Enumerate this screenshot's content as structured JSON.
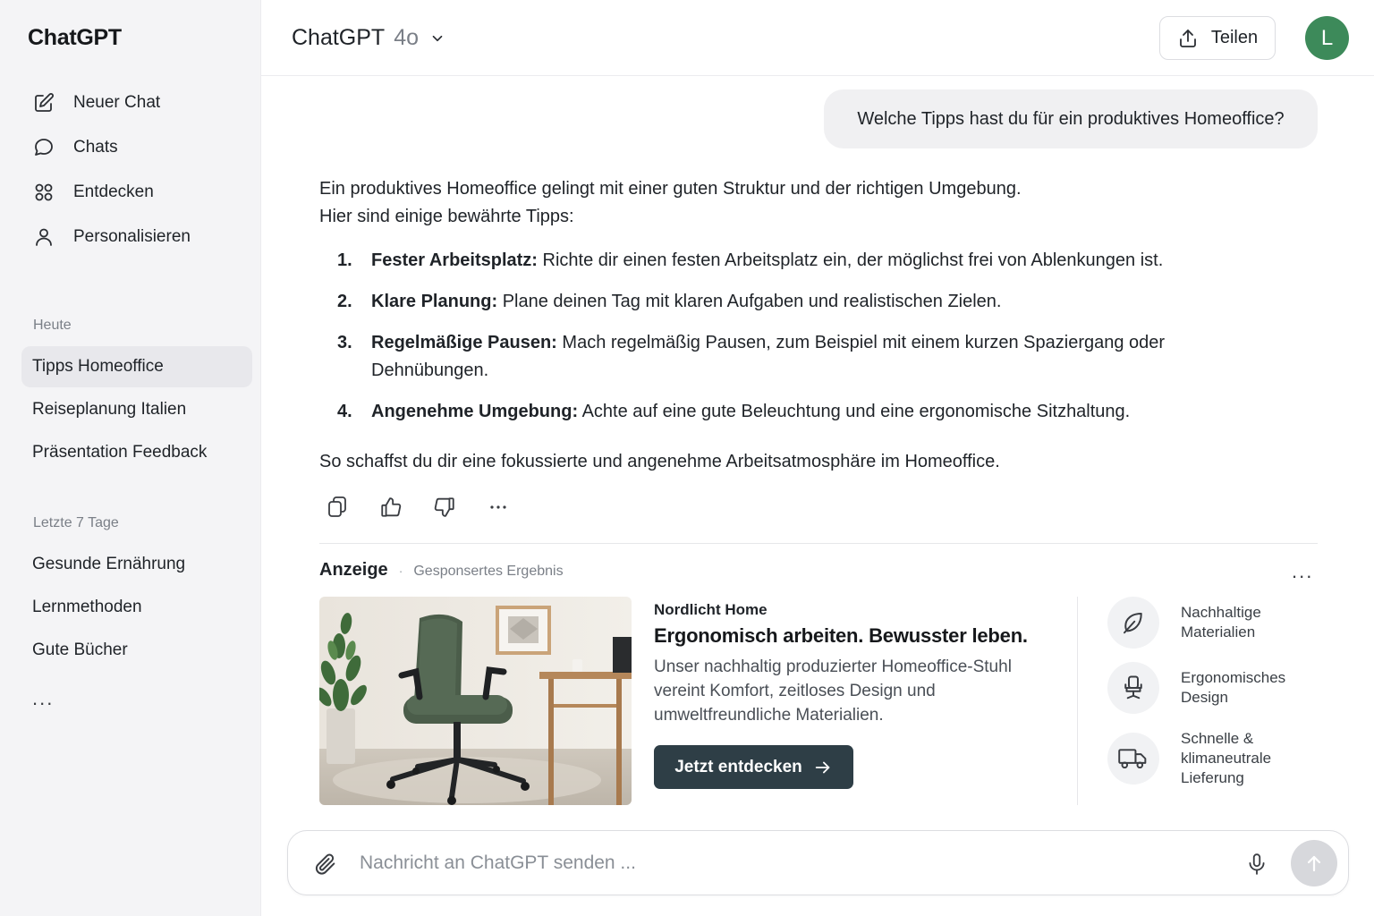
{
  "sidebar": {
    "brand": "ChatGPT",
    "nav": [
      {
        "label": "Neuer Chat",
        "icon": "edit-icon"
      },
      {
        "label": "Chats",
        "icon": "chat-bubble-icon"
      },
      {
        "label": "Entdecken",
        "icon": "grid-icon"
      },
      {
        "label": "Personalisieren",
        "icon": "person-icon"
      }
    ],
    "sections": [
      {
        "label": "Heute",
        "items": [
          "Tipps Homeoffice",
          "Reiseplanung Italien",
          "Präsentation Feedback"
        ]
      },
      {
        "label": "Letzte 7 Tage",
        "items": [
          "Gesunde Ernährung",
          "Lernmethoden",
          "Gute Bücher"
        ]
      }
    ],
    "active_item": "Tipps Homeoffice",
    "more": "..."
  },
  "header": {
    "model_name": "ChatGPT",
    "model_version": "4o",
    "share_label": "Teilen",
    "avatar_initial": "L",
    "avatar_color": "#3d8a5a"
  },
  "conversation": {
    "user_message": "Welche Tipps hast du für ein produktives Homeoffice?",
    "answer": {
      "intro_line1": "Ein produktives Homeoffice gelingt mit einer guten Struktur und der richtigen Umgebung.",
      "intro_line2": "Hier sind einige bewährte Tipps:",
      "tips": [
        {
          "num": "1.",
          "title": "Fester Arbeitsplatz:",
          "text": "Richte dir einen festen Arbeitsplatz ein, der möglichst frei von Ablenkungen ist."
        },
        {
          "num": "2.",
          "title": "Klare Planung:",
          "text": "Plane deinen Tag mit klaren Aufgaben und realistischen Zielen."
        },
        {
          "num": "3.",
          "title": "Regelmäßige Pausen:",
          "text": "Mach regelmäßig Pausen, zum Beispiel mit einem kurzen Spaziergang oder Dehnübungen."
        },
        {
          "num": "4.",
          "title": "Angenehme Umgebung:",
          "text": "Achte auf eine gute Beleuchtung und eine ergonomische Sitzhaltung."
        }
      ],
      "outro": "So schaffst du dir eine fokussierte und angenehme Arbeitsatmosphäre im Homeoffice."
    },
    "actions": [
      "copy-icon",
      "thumbs-up-icon",
      "thumbs-down-icon",
      "more-icon"
    ]
  },
  "ad": {
    "label": "Anzeige",
    "separator": "·",
    "sublabel": "Gesponsertes Ergebnis",
    "more": "...",
    "brand": "Nordlicht Home",
    "title": "Ergonomisch arbeiten. Bewusster leben.",
    "description": "Unser nachhaltig produzierter Homeoffice-Stuhl vereint Komfort, zeitloses Design und umweltfreundliche Materialien.",
    "cta": "Jetzt entdecken",
    "cta_color": "#2e3e46",
    "features": [
      {
        "icon": "leaf-icon",
        "label": "Nachhaltige Materialien"
      },
      {
        "icon": "chair-icon",
        "label": "Ergonomisches Design"
      },
      {
        "icon": "truck-icon",
        "label": "Schnelle & klimaneutrale Lieferung"
      }
    ]
  },
  "composer": {
    "placeholder": "Nachricht an ChatGPT senden ...",
    "value": ""
  }
}
